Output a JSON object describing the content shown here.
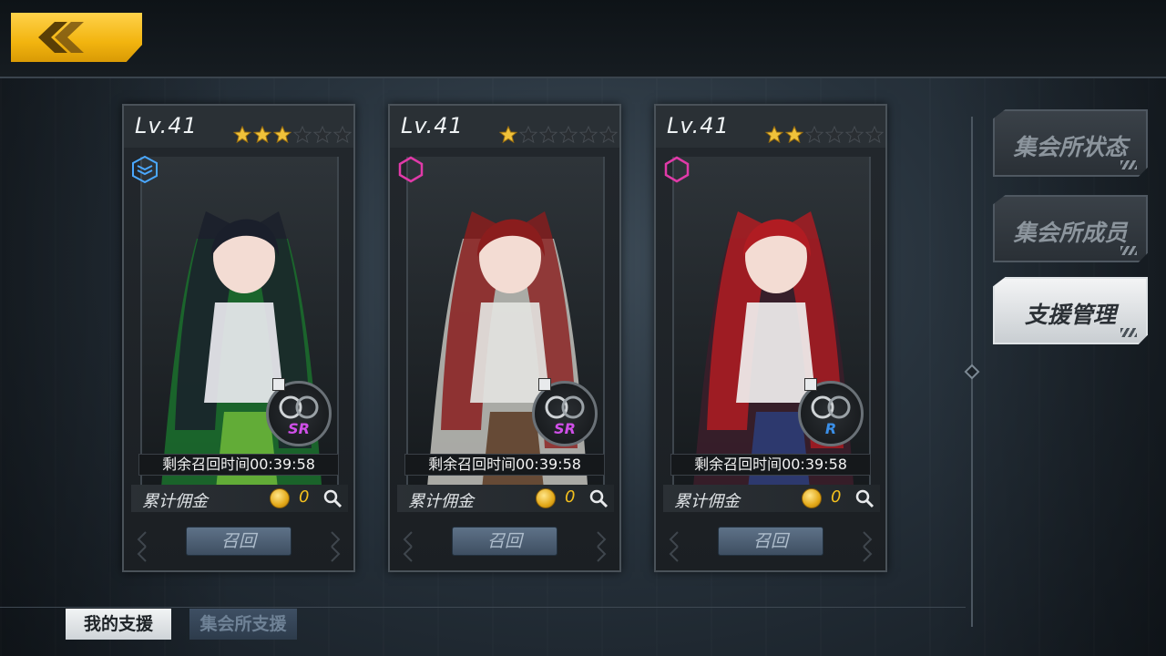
{
  "nav": {
    "back": "back"
  },
  "cards": [
    {
      "level": "Lv.41",
      "stars_filled": 3,
      "stars_total": 6,
      "type_icon": "layers-icon",
      "type_color": "#4aa8ff",
      "weapon_rarity": "SR",
      "rarity_color": "#d04fe8",
      "timer": "剩余召回时间00:39:58",
      "fee_label": "累计佣金",
      "fee_value": "0",
      "recall_label": "召回",
      "art_palette": [
        "#1b6b2c",
        "#1a1f2b",
        "#e9e9ef",
        "#70b83a"
      ]
    },
    {
      "level": "Lv.41",
      "stars_filled": 1,
      "stars_total": 6,
      "type_icon": "hexagon-icon",
      "type_color": "#e03aa8",
      "weapon_rarity": "SR",
      "rarity_color": "#d04fe8",
      "timer": "剩余召回时间00:39:58",
      "fee_label": "累计佣金",
      "fee_value": "0",
      "recall_label": "召回",
      "art_palette": [
        "#b9b9b4",
        "#8a1d1d",
        "#e3e3e0",
        "#5a3a22"
      ]
    },
    {
      "level": "Lv.41",
      "stars_filled": 2,
      "stars_total": 6,
      "type_icon": "hexagon-icon",
      "type_color": "#e03aa8",
      "weapon_rarity": "R",
      "rarity_color": "#3a8fe8",
      "timer": "剩余召回时间00:39:58",
      "fee_label": "累计佣金",
      "fee_value": "0",
      "recall_label": "召回",
      "art_palette": [
        "#3a1e2a",
        "#b01c22",
        "#f0eeee",
        "#2b3e7a"
      ]
    }
  ],
  "side_tabs": [
    {
      "label": "集会所状态",
      "active": false
    },
    {
      "label": "集会所成员",
      "active": false
    },
    {
      "label": "支援管理",
      "active": true
    }
  ],
  "bottom_tabs": [
    {
      "label": "我的支援",
      "active": true
    },
    {
      "label": "集会所支援",
      "active": false
    }
  ],
  "colors": {
    "accent_gold": "#f2b40f",
    "fee_gold": "#f4c01e",
    "star_gold": "#f0c23a"
  }
}
